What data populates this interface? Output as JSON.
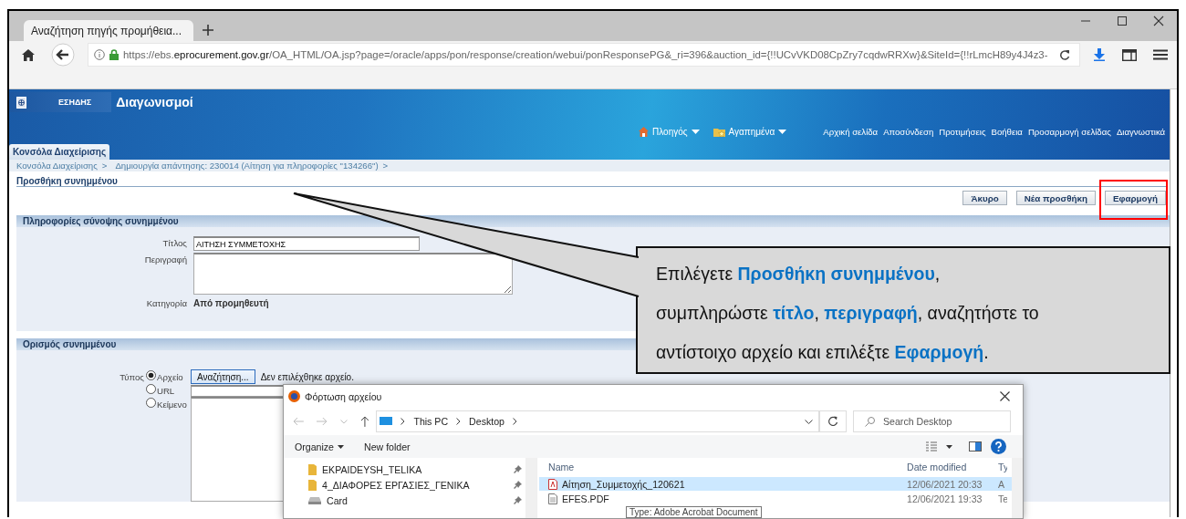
{
  "browser": {
    "tab_title": "Αναζήτηση πηγής προμήθεια...",
    "url": "https://ebs.**eprocurement.gov.gr**/OA_HTML/OA.jsp?page=/oracle/apps/pon/response/creation/webui/ponResponsePG&_ri=396&auction_id={!!UCvVKD08CpZry7cqdwRRXw}&SiteId={!!rLmcH89y4J4z3-"
  },
  "header": {
    "logo_text": "ΕΣΗΔΗΣ",
    "app_title": "Διαγωνισμοί",
    "menus": [
      {
        "label": "Πλοηγός",
        "kind": "navigator"
      },
      {
        "label": "Αγαπημένα",
        "kind": "favorites"
      }
    ],
    "links": [
      "Αρχική σελίδα",
      "Αποσύνδεση",
      "Προτιμήσεις",
      "Βοήθεια",
      "Προσαρμογή σελίδας",
      "Διαγνωστικά"
    ],
    "tabs": [
      {
        "label": "Κονσόλα Διαχείρισης",
        "selected": true
      }
    ]
  },
  "breadcrumbs": {
    "separator": ">",
    "items": [
      "Κονσόλα Διαχείρισης",
      "Δημιουργία απάντησης: 230014 (Αίτηση για πληροφορίες \"134266\")"
    ]
  },
  "page_title": "Προσθήκη συνημμένου",
  "buttons": [
    {
      "label": "Άκυρο",
      "highlighted": false
    },
    {
      "label": "Νέα προσθήκη",
      "highlighted": false
    },
    {
      "label": "Εφαρμογή",
      "highlighted": true
    }
  ],
  "summary_section": {
    "title": "Πληροφορίες σύνοψης συνημμένου",
    "fields": [
      {
        "label": "Τίτλος",
        "kind": "text",
        "value": "ΑΙΤΗΣΗ ΣΥΜΜΕΤΟΧΗΣ"
      },
      {
        "label": "Περιγραφή",
        "kind": "textarea"
      },
      {
        "label": "Κατηγορία",
        "kind": "static",
        "value": "Από προμηθευτή"
      }
    ]
  },
  "definition_section": {
    "title": "Ορισμός συνημμένου",
    "type_label": "Τύπος",
    "options": [
      {
        "label": "Αρχείο",
        "selected": true
      },
      {
        "label": "URL",
        "selected": false
      },
      {
        "label": "Κείμενο",
        "selected": false
      }
    ],
    "browse_button": "Αναζήτηση...",
    "file_status": "Δεν επιλέχθηκε αρχείο."
  },
  "callout": {
    "text": "Επιλέγετε **Προσθήκη συνημμένου**,\nσυμπληρώστε **τίτλο**, **περιγραφή**, αναζητήστε το\nαντίστοιχο αρχείο και επιλέξτε **Εφαρμογή**."
  },
  "file_dialog": {
    "title": "Φόρτωση αρχείου",
    "path": [
      "This PC",
      "Desktop"
    ],
    "search_placeholder": "Search Desktop",
    "toolbar": [
      {
        "label": "Organize",
        "kind": "menu"
      },
      {
        "label": "New folder",
        "kind": "button"
      }
    ],
    "nav_items": [
      {
        "label": "EKPAIDEYSH_TELIKA",
        "kind": "folder"
      },
      {
        "label": "4_ΔΙΑΦΟΡΕΣ ΕΡΓΑΣΙΕΣ_ΓΕΝΙΚΑ",
        "kind": "folder"
      },
      {
        "label": "Card",
        "kind": "drive"
      }
    ],
    "columns": [
      "Name",
      "Date modified",
      "Ty"
    ],
    "files": [
      {
        "name": "Αίτηση_Συμμετοχής_120621",
        "date": "12/06/2021 20:33",
        "type": "A",
        "kind": "pdf",
        "selected": true
      },
      {
        "name": "EFES.PDF",
        "date": "12/06/2021 19:33",
        "type": "Te",
        "kind": "document",
        "selected": false
      }
    ],
    "tooltip": "Type: Adobe Acrobat Document"
  }
}
